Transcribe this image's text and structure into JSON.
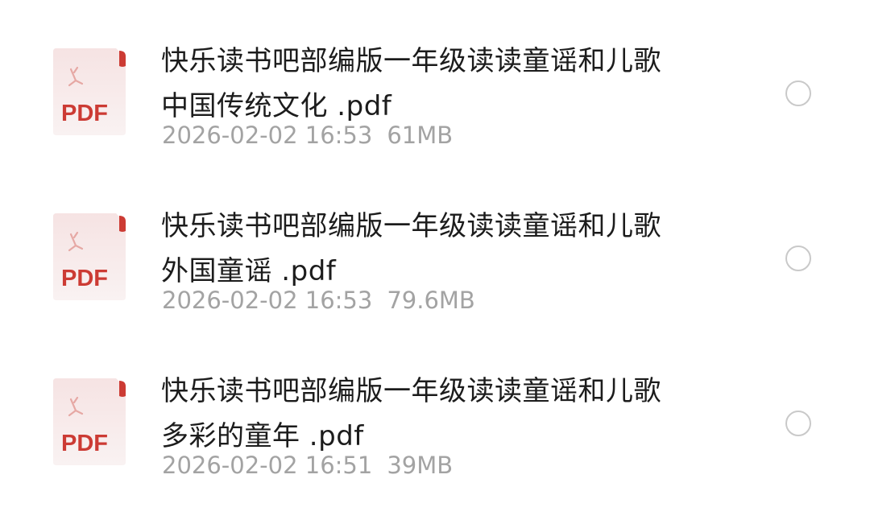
{
  "files": [
    {
      "name_line1": "快乐读书吧部编版一年级读读童谣和儿歌",
      "name_line2": "中国传统文化 .pdf",
      "date": "2026-02-02 16:53",
      "size": "61MB",
      "icon": "pdf-file-icon",
      "icon_label": "PDF",
      "selected": false
    },
    {
      "name_line1": "快乐读书吧部编版一年级读读童谣和儿歌",
      "name_line2": "外国童谣 .pdf",
      "date": "2026-02-02 16:53",
      "size": "79.6MB",
      "icon": "pdf-file-icon",
      "icon_label": "PDF",
      "selected": false
    },
    {
      "name_line1": "快乐读书吧部编版一年级读读童谣和儿歌",
      "name_line2": "多彩的童年 .pdf",
      "date": "2026-02-02 16:51",
      "size": "39MB",
      "icon": "pdf-file-icon",
      "icon_label": "PDF",
      "selected": false
    }
  ],
  "colors": {
    "pdf_red": "#cc3b34",
    "icon_bg": "#f7eded",
    "title_text": "#1c1c1c",
    "meta_text": "#a3a3a3",
    "radio_border": "#c9c9c9"
  }
}
